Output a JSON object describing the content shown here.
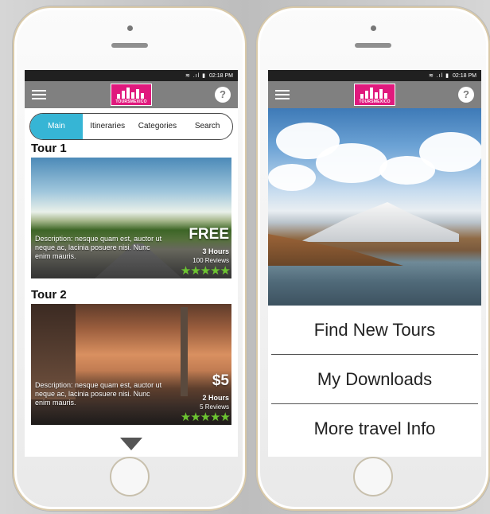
{
  "status_bar": {
    "time": "02:18 PM",
    "icons": "≋ .ıl ▮"
  },
  "app": {
    "logo_text": "TOURSMEXICO",
    "help_label": "?"
  },
  "tabs": [
    {
      "label": "Main",
      "active": true
    },
    {
      "label": "Itineraries",
      "active": false
    },
    {
      "label": "Categories",
      "active": false
    },
    {
      "label": "Search",
      "active": false
    }
  ],
  "tours": [
    {
      "title": "Tour 1",
      "description": "Description: nesque quam est, auctor ut neque ac, lacinia posuere nisi. Nunc enim mauris.",
      "price": "FREE",
      "duration": "3 Hours",
      "reviews": "100 Reviews",
      "rating": 5
    },
    {
      "title": "Tour 2",
      "description": "Description: nesque quam est, auctor ut neque ac, lacinia posuere nisi. Nunc enim mauris.",
      "price": "$5",
      "duration": "2 Hours",
      "reviews": "5 Reviews",
      "rating": 5
    }
  ],
  "home_menu": [
    {
      "label": "Find New Tours"
    },
    {
      "label": "My Downloads"
    },
    {
      "label": "More travel Info"
    }
  ],
  "colors": {
    "accent": "#36b5d5",
    "brand": "#e0197d",
    "appbar": "#808080",
    "star": "#6cc431"
  }
}
